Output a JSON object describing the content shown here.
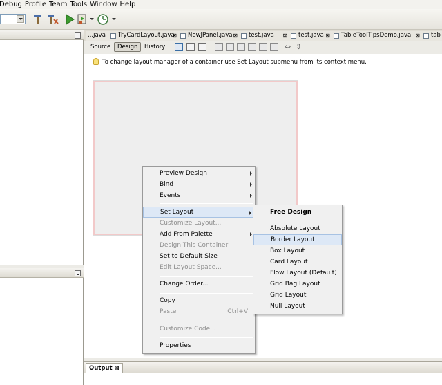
{
  "menubar": [
    "Debug",
    "Profile",
    "Team",
    "Tools",
    "Window",
    "Help"
  ],
  "editor_tabs": [
    {
      "label": "...java"
    },
    {
      "label": "TryCardLayout.java"
    },
    {
      "label": "NewJPanel.java"
    },
    {
      "label": "test.java"
    },
    {
      "label": "test.java"
    },
    {
      "label": "TableToolTipsDemo.java"
    },
    {
      "label": "tab"
    }
  ],
  "view_buttons": {
    "source": "Source",
    "design": "Design",
    "history": "History"
  },
  "hint": "To change layout manager of a container use Set Layout submenu from its context menu.",
  "context_menu": [
    {
      "label": "Preview Design",
      "submenu": true
    },
    {
      "label": "Bind",
      "submenu": true
    },
    {
      "label": "Events",
      "submenu": true
    },
    {
      "label": "Set Layout",
      "submenu": true,
      "highlighted": true
    },
    {
      "label": "Customize Layout...",
      "disabled": true
    },
    {
      "label": "Add From Palette",
      "submenu": true
    },
    {
      "label": "Design This Container",
      "disabled": true
    },
    {
      "label": "Set to Default Size"
    },
    {
      "label": "Edit Layout Space...",
      "disabled": true
    },
    {
      "label": "Change Order..."
    },
    {
      "label": "Copy"
    },
    {
      "label": "Paste",
      "shortcut": "Ctrl+V",
      "disabled": true
    },
    {
      "label": "Customize Code...",
      "disabled": true
    },
    {
      "label": "Properties"
    }
  ],
  "layout_submenu": [
    {
      "label": "Free Design",
      "bold": true
    },
    {
      "label": "Absolute Layout"
    },
    {
      "label": "Border Layout",
      "highlighted": true
    },
    {
      "label": "Box Layout"
    },
    {
      "label": "Card Layout"
    },
    {
      "label": "Flow Layout (Default)"
    },
    {
      "label": "Grid Bag Layout"
    },
    {
      "label": "Grid Layout"
    },
    {
      "label": "Null Layout"
    }
  ],
  "output_tab": "Output",
  "close_glyph": "⊠"
}
